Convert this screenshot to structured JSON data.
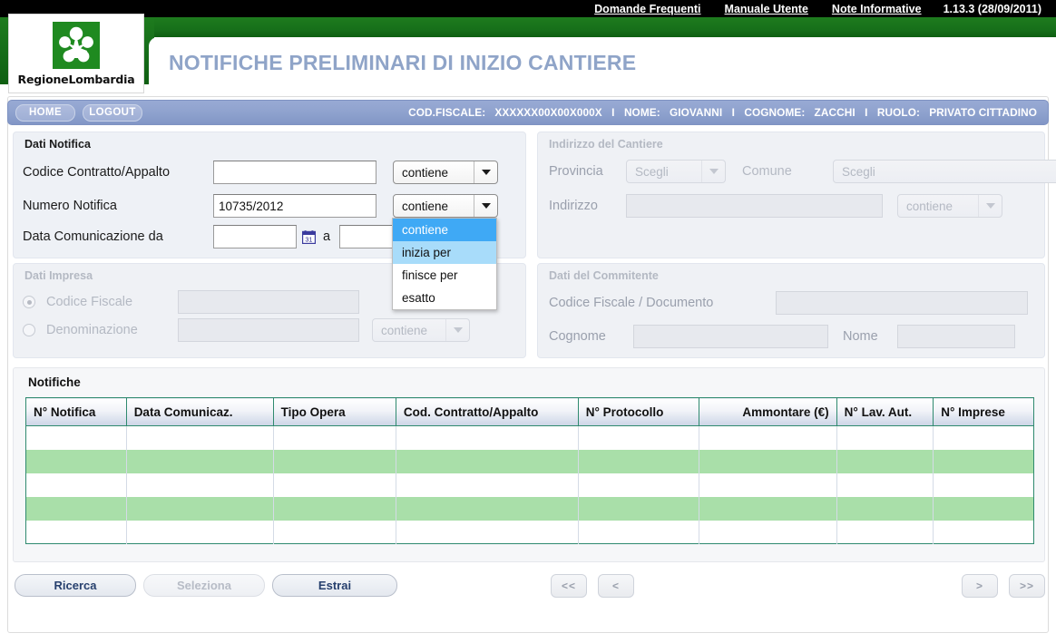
{
  "topbar": {
    "links": [
      "Domande Frequenti",
      "Manuale Utente",
      "Note Informative"
    ],
    "version": "1.13.3 (28/09/2011)"
  },
  "header": {
    "logo_text": "RegioneLombardia",
    "app_title": "NOTIFICHE PRELIMINARI DI INIZIO CANTIERE"
  },
  "userbar": {
    "home_label": "HOME",
    "logout_label": "LOGOUT",
    "cod_fiscale_label": "COD.FISCALE:",
    "cod_fiscale_value": "XXXXXX00X00X000X",
    "nome_label": "NOME:",
    "nome_value": "GIOVANNI",
    "cognome_label": "COGNOME:",
    "cognome_value": "ZACCHI",
    "ruolo_label": "RUOLO:",
    "ruolo_value": "PRIVATO CITTADINO",
    "separator": "I"
  },
  "dati_notifica": {
    "title": "Dati Notifica",
    "codice_contratto_label": "Codice Contratto/Appalto",
    "codice_contratto_value": "",
    "codice_contratto_operator": "contiene",
    "numero_notifica_label": "Numero Notifica",
    "numero_notifica_value": "10735/2012",
    "numero_notifica_operator": "contiene",
    "data_com_label": "Data Comunicazione da",
    "data_com_da_value": "",
    "data_com_a_label": "a",
    "data_com_a_value": ""
  },
  "dropdown": {
    "options": [
      "contiene",
      "inizia per",
      "finisce per",
      "esatto"
    ],
    "selected": "contiene",
    "hovered": "inizia per"
  },
  "indirizzo_cantiere": {
    "title": "Indirizzo del Cantiere",
    "provincia_label": "Provincia",
    "provincia_value": "Scegli",
    "comune_label": "Comune",
    "comune_value": "Scegli",
    "indirizzo_label": "Indirizzo",
    "indirizzo_value": "",
    "indirizzo_operator": "contiene"
  },
  "dati_impresa": {
    "title": "Dati Impresa",
    "codice_fiscale_label": "Codice Fiscale",
    "codice_fiscale_value": "",
    "denominazione_label": "Denominazione",
    "denominazione_value": "",
    "denominazione_operator": "contiene"
  },
  "dati_commitente": {
    "title": "Dati del Commitente",
    "cf_doc_label": "Codice Fiscale / Documento",
    "cf_doc_value": "",
    "cognome_label": "Cognome",
    "cognome_value": "",
    "nome_label": "Nome",
    "nome_value": ""
  },
  "results": {
    "title": "Notifiche",
    "columns": [
      "N° Notifica",
      "Data Comunicaz.",
      "Tipo Opera",
      "Cod. Contratto/Appalto",
      "N° Protocollo",
      "Ammontare (€)",
      "N° Lav. Aut.",
      "N° Imprese"
    ],
    "rows": [
      [
        "",
        "",
        "",
        "",
        "",
        "",
        "",
        ""
      ],
      [
        "",
        "",
        "",
        "",
        "",
        "",
        "",
        ""
      ],
      [
        "",
        "",
        "",
        "",
        "",
        "",
        "",
        ""
      ],
      [
        "",
        "",
        "",
        "",
        "",
        "",
        "",
        ""
      ],
      [
        "",
        "",
        "",
        "",
        "",
        "",
        "",
        ""
      ]
    ]
  },
  "actions": {
    "ricerca": "Ricerca",
    "seleziona": "Seleziona",
    "estrai": "Estrai",
    "first": "<<",
    "prev": "<",
    "next": ">",
    "last": ">>"
  },
  "colors": {
    "brand_green": "#1f8a20",
    "title_blue": "#8fa4c8",
    "userbar_blue": "#8fa2ce",
    "row_green": "#a9dfa9",
    "grid_border": "#2f8a6f",
    "dropdown_selected": "#3fa9f5",
    "dropdown_hover": "#a8dcfa"
  }
}
